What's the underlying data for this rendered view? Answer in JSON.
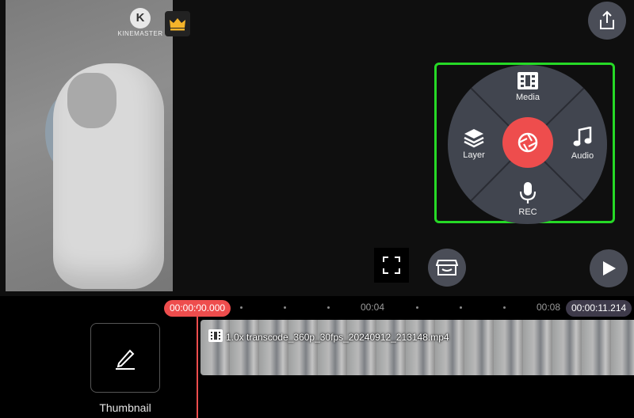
{
  "app": {
    "logo_text": "KINEMASTER",
    "logo_letter": "K"
  },
  "wheel_menu": {
    "media_label": "Media",
    "layer_label": "Layer",
    "audio_label": "Audio",
    "rec_label": "REC"
  },
  "timeline": {
    "current_time": "00:00:00.000",
    "total_time": "00:00:11.214",
    "tick_labels": [
      "00:04",
      "00:08"
    ],
    "clip_name": "1.0x transcode_360p_30fps_20240912_213148.mp4"
  },
  "thumbnail": {
    "label": "Thumbnail"
  },
  "colors": {
    "accent": "#ee4d4d",
    "highlight": "#26d926",
    "button_bg": "#4a4d57"
  },
  "icons": [
    "crown-icon",
    "share-icon",
    "media-icon",
    "layer-icon",
    "audio-icon",
    "mic-icon",
    "shutter-icon",
    "fullscreen-icon",
    "store-icon",
    "play-icon",
    "pencil-icon",
    "film-icon"
  ]
}
